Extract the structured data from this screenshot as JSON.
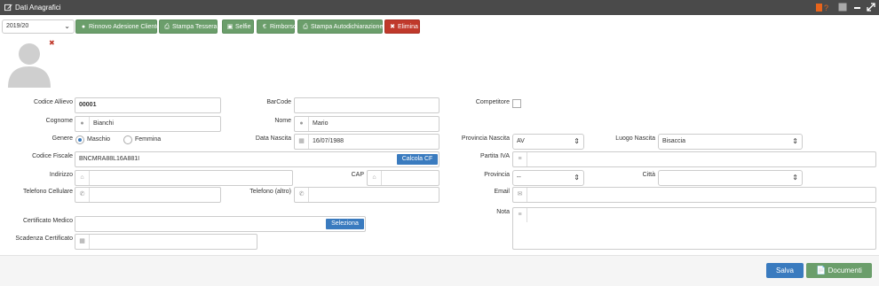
{
  "window": {
    "title": "Dati Anagrafici",
    "title_icon": "edit-icon",
    "controls": [
      "book-help-icon",
      "square-icon",
      "minimize-icon",
      "expand-icon"
    ]
  },
  "toolbar": {
    "season_select": "2019/20",
    "buttons": [
      {
        "label": "Rinnovo Adesione Cliente",
        "icon": "user-icon"
      },
      {
        "label": "Stampa Tessera",
        "icon": "print-icon"
      },
      {
        "label": "Selfie",
        "icon": "camera-icon"
      },
      {
        "label": "Rimborso",
        "icon": "euro-icon"
      },
      {
        "label": "Stampa Autodichiarazione",
        "icon": "print-icon"
      },
      {
        "label": "Elimina",
        "icon": "x-icon"
      }
    ]
  },
  "form": {
    "codice_allievo": {
      "label": "Codice Allievo",
      "value": "00001"
    },
    "barcode": {
      "label": "BarCode",
      "value": ""
    },
    "competitore": {
      "label": "Competitore",
      "checked": false
    },
    "cognome": {
      "label": "Cognome",
      "value": "Bianchi"
    },
    "nome": {
      "label": "Nome",
      "value": "Mario"
    },
    "genere": {
      "label": "Genere",
      "options": [
        "Maschio",
        "Femmina"
      ],
      "selected": "Maschio"
    },
    "data_nascita": {
      "label": "Data Nascita",
      "value": "16/07/1988"
    },
    "provincia_nascita": {
      "label": "Provincia Nascita",
      "value": "AV"
    },
    "luogo_nascita": {
      "label": "Luogo Nascita",
      "value": "Bisaccia"
    },
    "codice_fiscale": {
      "label": "Codice Fiscale",
      "value": "BNCMRA88L16A881I",
      "button": "Calcola CF"
    },
    "partita_iva": {
      "label": "Partita IVA",
      "value": ""
    },
    "indirizzo": {
      "label": "Indirizzo",
      "value": ""
    },
    "cap": {
      "label": "CAP",
      "value": ""
    },
    "provincia": {
      "label": "Provincia",
      "value": "--"
    },
    "citta": {
      "label": "Città",
      "value": ""
    },
    "telefono_cellulare": {
      "label": "Telefono Cellulare",
      "value": ""
    },
    "telefono_altro": {
      "label": "Telefono (altro)",
      "value": ""
    },
    "email": {
      "label": "Email",
      "value": ""
    },
    "certificato_medico": {
      "label": "Certificato Medico",
      "value": "",
      "button": "Seleziona"
    },
    "nota": {
      "label": "Nota",
      "value": ""
    },
    "scadenza_certificato": {
      "label": "Scadenza Certificato",
      "value": ""
    }
  },
  "footer": {
    "save_label": "Salva",
    "documents_label": "Documenti"
  },
  "colors": {
    "titlebar": "#4a4a4a",
    "green_button": "#6b9e6b",
    "red_button": "#c0392b",
    "blue": "#3a7bbf",
    "orange_icon": "#e8641b"
  }
}
